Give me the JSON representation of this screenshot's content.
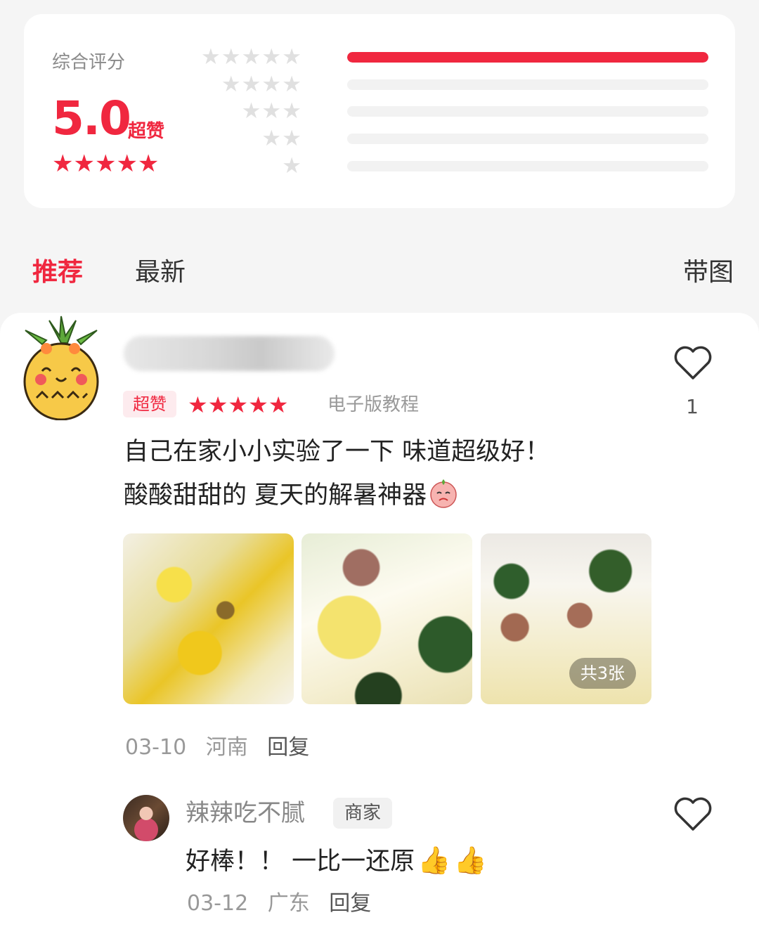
{
  "summary": {
    "label": "综合评分",
    "score": "5.0",
    "score_word": "超赞",
    "stars": "★★★★★",
    "distribution": [
      {
        "stars": "★★★★★",
        "fraction": 1.0
      },
      {
        "stars": "★★★★",
        "fraction": 0.0
      },
      {
        "stars": "★★★",
        "fraction": 0.0
      },
      {
        "stars": "★★",
        "fraction": 0.0
      },
      {
        "stars": "★",
        "fraction": 0.0
      }
    ]
  },
  "tabs": {
    "recommended": "推荐",
    "latest": "最新",
    "with_images": "带图"
  },
  "review": {
    "badge": "超赞",
    "stars": "★★★★★",
    "tag": "电子版教程",
    "likes": "1",
    "text_line1": "自己在家小小实验了一下 味道超级好！",
    "text_line2": "酸酸甜甜的 夏天的解暑神器",
    "photo_count": "共3张",
    "date": "03-10",
    "location": "河南",
    "reply_label": "回复"
  },
  "reply": {
    "name": "辣辣吃不腻",
    "badge": "商家",
    "text": "好棒！！ 一比一还原",
    "date": "03-12",
    "location": "广东",
    "reply_label": "回复"
  },
  "colors": {
    "accent": "#f0273f",
    "thumbs": "#f2b234"
  }
}
